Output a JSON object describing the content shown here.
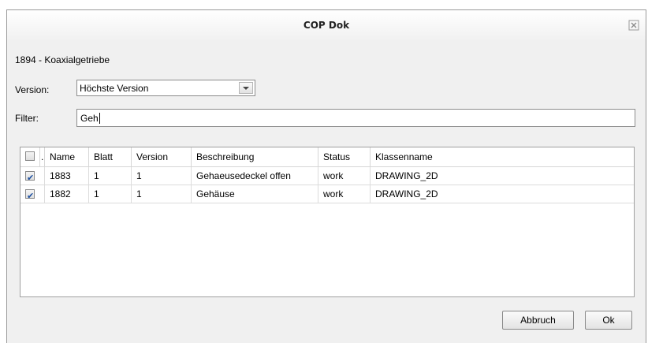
{
  "dialog": {
    "title": "COP Dok"
  },
  "document": {
    "label": "1894 - Koaxialgetriebe"
  },
  "version": {
    "label": "Version:",
    "selected": "Höchste Version"
  },
  "filter": {
    "label": "Filter:",
    "value": "Geh"
  },
  "table": {
    "columns": [
      "",
      ".",
      "Name",
      "Blatt",
      "Version",
      "Beschreibung",
      "Status",
      "Klassenname"
    ],
    "rows": [
      {
        "checked": true,
        "name": "1883",
        "blatt": "1",
        "version": "1",
        "beschreibung": "Gehaeusedeckel offen",
        "status": "work",
        "klassenname": "DRAWING_2D"
      },
      {
        "checked": true,
        "name": "1882",
        "blatt": "1",
        "version": "1",
        "beschreibung": "Gehäuse",
        "status": "work",
        "klassenname": "DRAWING_2D"
      }
    ]
  },
  "buttons": {
    "cancel": "Abbruch",
    "ok": "Ok"
  },
  "icons": {
    "close": "close-icon",
    "dropdown": "chevron-down-icon"
  }
}
